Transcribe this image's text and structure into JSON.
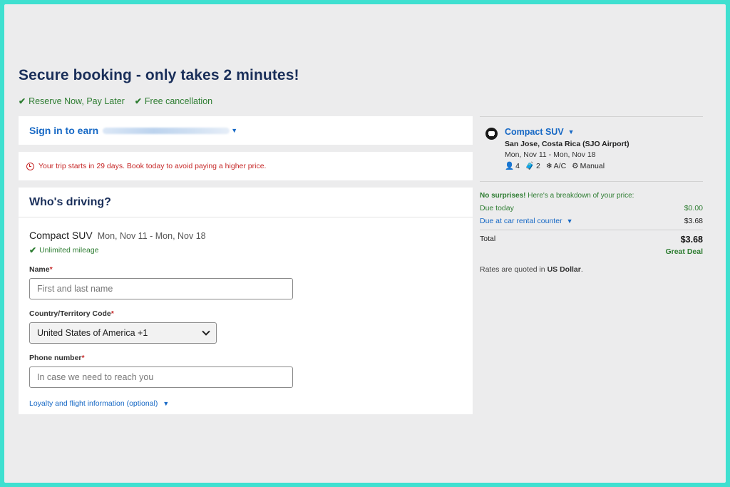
{
  "header": {
    "title": "Secure booking - only takes 2 minutes!",
    "perks": [
      "Reserve Now, Pay Later",
      "Free cancellation"
    ]
  },
  "signin": {
    "label": "Sign in to earn"
  },
  "alert": {
    "text": "Your trip starts in 29 days. Book today to avoid paying a higher price."
  },
  "driver": {
    "title": "Who's driving?",
    "car_name": "Compact SUV",
    "dates": "Mon, Nov 11 - Mon, Nov 18",
    "mileage": "Unlimited mileage",
    "name_label": "Name",
    "name_placeholder": "First and last name",
    "country_label": "Country/Territory Code",
    "country_value": "United States of America +1",
    "phone_label": "Phone number",
    "phone_placeholder": "In case we need to reach you",
    "required_mark": "*",
    "loyalty_link": "Loyalty and flight information (optional)"
  },
  "summary": {
    "car_name": "Compact SUV",
    "location": "San Jose, Costa Rica (SJO Airport)",
    "dates": "Mon, Nov 11 - Mon, Nov 18",
    "features": {
      "passengers": "4",
      "bags": "2",
      "ac": "A/C",
      "transmission": "Manual"
    },
    "breakdown_intro_bold": "No surprises!",
    "breakdown_intro_rest": " Here's a breakdown of your price:",
    "due_today_label": "Due today",
    "due_today_value": "$0.00",
    "due_counter_label": "Due at car rental counter",
    "due_counter_value": "$3.68",
    "total_label": "Total",
    "total_value": "$3.68",
    "deal_label": "Great Deal",
    "rates_prefix": "Rates are quoted in ",
    "rates_currency": "US Dollar",
    "rates_suffix": "."
  },
  "colors": {
    "frame": "#3fe0d0",
    "background": "#ececed",
    "brand_blue": "#1668c5",
    "heading_navy": "#1a2f5a",
    "success_green": "#2e7d32",
    "alert_red": "#c62828"
  }
}
